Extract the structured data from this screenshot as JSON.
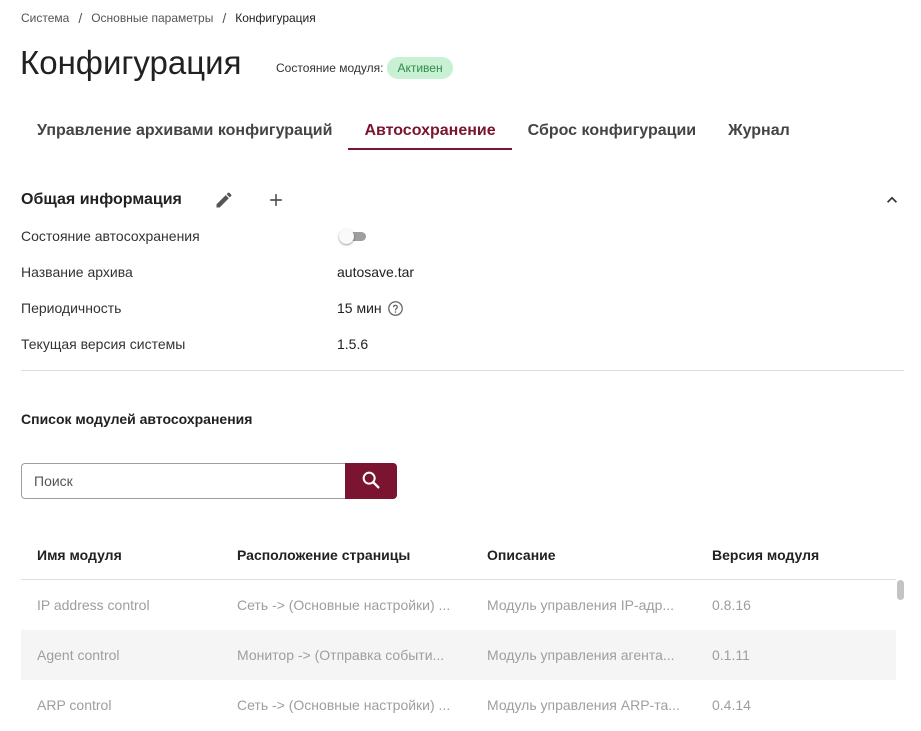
{
  "breadcrumb": {
    "items": [
      "Система",
      "Основные параметры"
    ],
    "current": "Конфигурация",
    "separator": "/"
  },
  "page": {
    "title": "Конфигурация",
    "module_state_label": "Состояние модуля:",
    "module_state_value": "Активен"
  },
  "tabs": [
    {
      "label": "Управление архивами конфигураций",
      "active": false
    },
    {
      "label": "Автосохранение",
      "active": true
    },
    {
      "label": "Сброс конфигурации",
      "active": false
    },
    {
      "label": "Журнал",
      "active": false
    }
  ],
  "general_info": {
    "title": "Общая информация",
    "icons": {
      "edit": "pencil-icon",
      "add": "plus-icon",
      "collapse": "chevron-up-icon"
    },
    "rows": [
      {
        "label": "Состояние автосохранения",
        "type": "toggle",
        "enabled": false
      },
      {
        "label": "Название архива",
        "value": "autosave.tar"
      },
      {
        "label": "Периодичность",
        "value": "15 мин",
        "help_icon": "question-circle-icon"
      },
      {
        "label": "Текущая версия системы",
        "value": "1.5.6"
      }
    ]
  },
  "modules_list": {
    "title": "Список модулей автосохранения",
    "search": {
      "placeholder": "Поиск",
      "value": "",
      "button_icon": "search-icon"
    },
    "columns": [
      "Имя модуля",
      "Расположение страницы",
      "Описание",
      "Версия модуля"
    ],
    "rows": [
      [
        "IP address control",
        "Сеть -> (Основные настройки) ...",
        "Модуль управления IP-адр...",
        "0.8.16"
      ],
      [
        "Agent control",
        "Монитор -> (Отправка событи...",
        "Модуль управления агента...",
        "0.1.11"
      ],
      [
        "ARP control",
        "Сеть -> (Основные настройки) ...",
        "Модуль управления ARP-та...",
        "0.4.14"
      ]
    ]
  },
  "colors": {
    "accent": "#7a1430",
    "badge_bg": "#c8f0d3",
    "badge_text": "#2e8b4a",
    "muted_text": "#9e9e9e"
  }
}
